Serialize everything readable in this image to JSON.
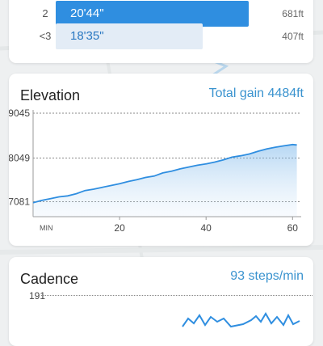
{
  "splits": [
    {
      "label": "2",
      "time": "20'44\"",
      "distance": "681ft",
      "fraction": 0.63
    },
    {
      "label": "<3",
      "time": "18'35\"",
      "distance": "407ft",
      "fraction": 0.48
    }
  ],
  "elevation": {
    "title": "Elevation",
    "total_gain": "Total gain 4484ft",
    "chart_data": {
      "type": "area",
      "title": "Elevation",
      "xlabel": "",
      "ylabel": "",
      "x_unit_label": "MIN",
      "x_ticks": [
        20,
        40,
        60
      ],
      "y_ticks": [
        9045,
        8049,
        7081
      ],
      "xlim": [
        0,
        62
      ],
      "ylim": [
        6750,
        9045
      ],
      "grid": true,
      "series": [
        {
          "x": [
            0,
            2,
            4,
            6,
            8,
            10,
            12,
            14,
            16,
            18,
            20,
            22,
            24,
            26,
            28,
            30,
            32,
            34,
            36,
            38,
            40,
            42,
            44,
            46,
            48,
            50,
            52,
            54,
            56,
            58,
            60,
            61
          ],
          "y": [
            7060,
            7110,
            7150,
            7190,
            7210,
            7260,
            7330,
            7360,
            7400,
            7440,
            7480,
            7530,
            7570,
            7620,
            7650,
            7720,
            7760,
            7810,
            7850,
            7890,
            7920,
            7960,
            8010,
            8070,
            8100,
            8140,
            8200,
            8250,
            8290,
            8320,
            8350,
            8340
          ]
        }
      ]
    }
  },
  "cadence": {
    "title": "Cadence",
    "stat": "93 steps/min",
    "y_tick": "191"
  },
  "colors": {
    "accent": "#2f8ee0",
    "stat_text": "#3a93cf",
    "background": "#eef0f1"
  }
}
